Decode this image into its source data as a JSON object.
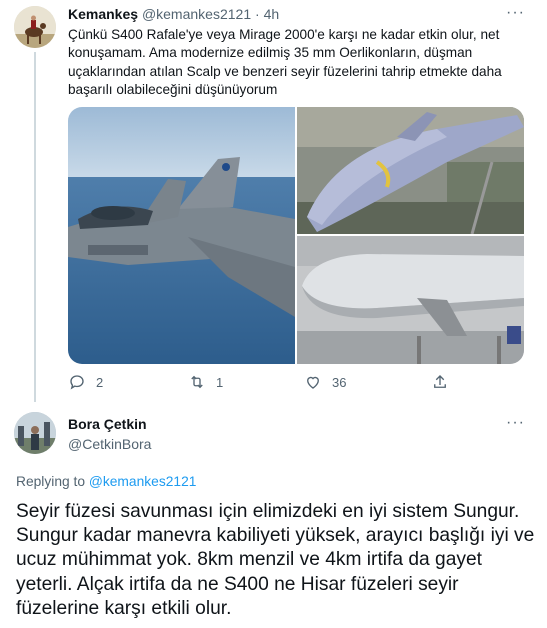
{
  "tweet": {
    "author_name": "Kemankeş",
    "author_handle": "@kemankes2121",
    "separator": "·",
    "time": "4h",
    "text": "Çünkü S400 Rafale'ye veya Mirage 2000'e  karşı ne kadar etkin olur, net konuşamam. Ama  modernize edilmiş 35 mm Oerlikonların, düşman uçaklarından atılan  Scalp ve benzeri seyir füzelerini tahrip etmekte daha başarılı olabileceğini düşünüyorum",
    "more_icon": "more-horizontal-icon",
    "media": [
      {
        "subject": "rafale-jet-photo"
      },
      {
        "subject": "scalp-missile-display-photo"
      },
      {
        "subject": "cruise-missile-closeup-photo"
      }
    ],
    "actions": {
      "reply_count": "2",
      "retweet_count": "1",
      "like_count": "36",
      "share_icon": "share-icon"
    }
  },
  "reply": {
    "author_name": "Bora Çetkin",
    "author_handle": "@CetkinBora",
    "replying_prefix": "Replying to ",
    "replying_to": "@kemankes2121",
    "text": "Seyir füzesi savunması için elimizdeki en iyi sistem Sungur. Sungur kadar manevra kabiliyeti yüksek, arayıcı başlığı iyi ve ucuz mühimmat yok. 8km menzil ve 4km irtifa da gayet yeterli. Alçak irtifa da ne S400 ne Hisar füzeleri seyir füzelerine karşı etkili olur."
  },
  "colors": {
    "text": "#0f1419",
    "secondary": "#536471",
    "link": "#1d9bf0",
    "thread_line": "#cfd9de"
  }
}
